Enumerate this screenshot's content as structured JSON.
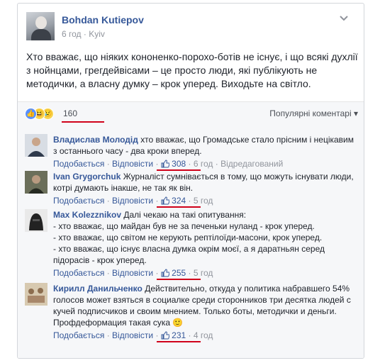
{
  "post": {
    "author": "Bohdan Kutiepov",
    "time": "6 год",
    "location": "Kyiv",
    "text": "Хто вважає, що ніяких кононенко-порохо-ботів не існує, і що всякі духлії з нойнцами, грегдейвісами – це просто люди, які публікують не методички, а власну думку – крок уперед. Виходьте на світло."
  },
  "reactions": {
    "count": "160",
    "sort_label": "Популярні коментарі",
    "colors": {
      "like": "#5890ff",
      "haha": "#f7d44f",
      "sad": "#f7d44f"
    }
  },
  "labels": {
    "like": "Подобається",
    "reply": "Відповісти",
    "separator": "·"
  },
  "comments": [
    {
      "name": "Владислав Молодід",
      "text": "хто вважає, що Громадське стало прісним і нецікавим з останнього часу - два кроки вперед.",
      "likes": "308",
      "time": "6 год",
      "edited": "Відредагований"
    },
    {
      "name": "Ivan Grygorchuk",
      "text": "Журналіст сумнівається в тому, що можуть існувати люди, котрі думають інакше, не так як він.",
      "likes": "324",
      "time": "5 год"
    },
    {
      "name": "Max Kolezznikov",
      "text": "Далі чекаю на такі опитування:",
      "lines": [
        "- хто вважає, що майдан був не за печеньки нуланд - крок уперед.",
        "- хто вважає, що світом не керують рептілоїди-масони, крок уперед.",
        "- хто вважає, що існує власна думка окрім моєї, а я даратньян серед підорасів - крок уперед."
      ],
      "likes": "255",
      "time": "5 год"
    },
    {
      "name": "Кирилл Данильченко",
      "text": "Действительно, откуда у политика набравшего 54% голосов может взяться в социалке среди сторонников три десятка людей с кучей подписчиков и своим мнением. Только боты, методички и деньги. Профдеформация такая сука",
      "emoji": "🙂",
      "likes": "231",
      "time": "4 год"
    }
  ],
  "accent_colors": {
    "link": "#365899",
    "muted": "#90949c",
    "underline": "#d0021b"
  }
}
